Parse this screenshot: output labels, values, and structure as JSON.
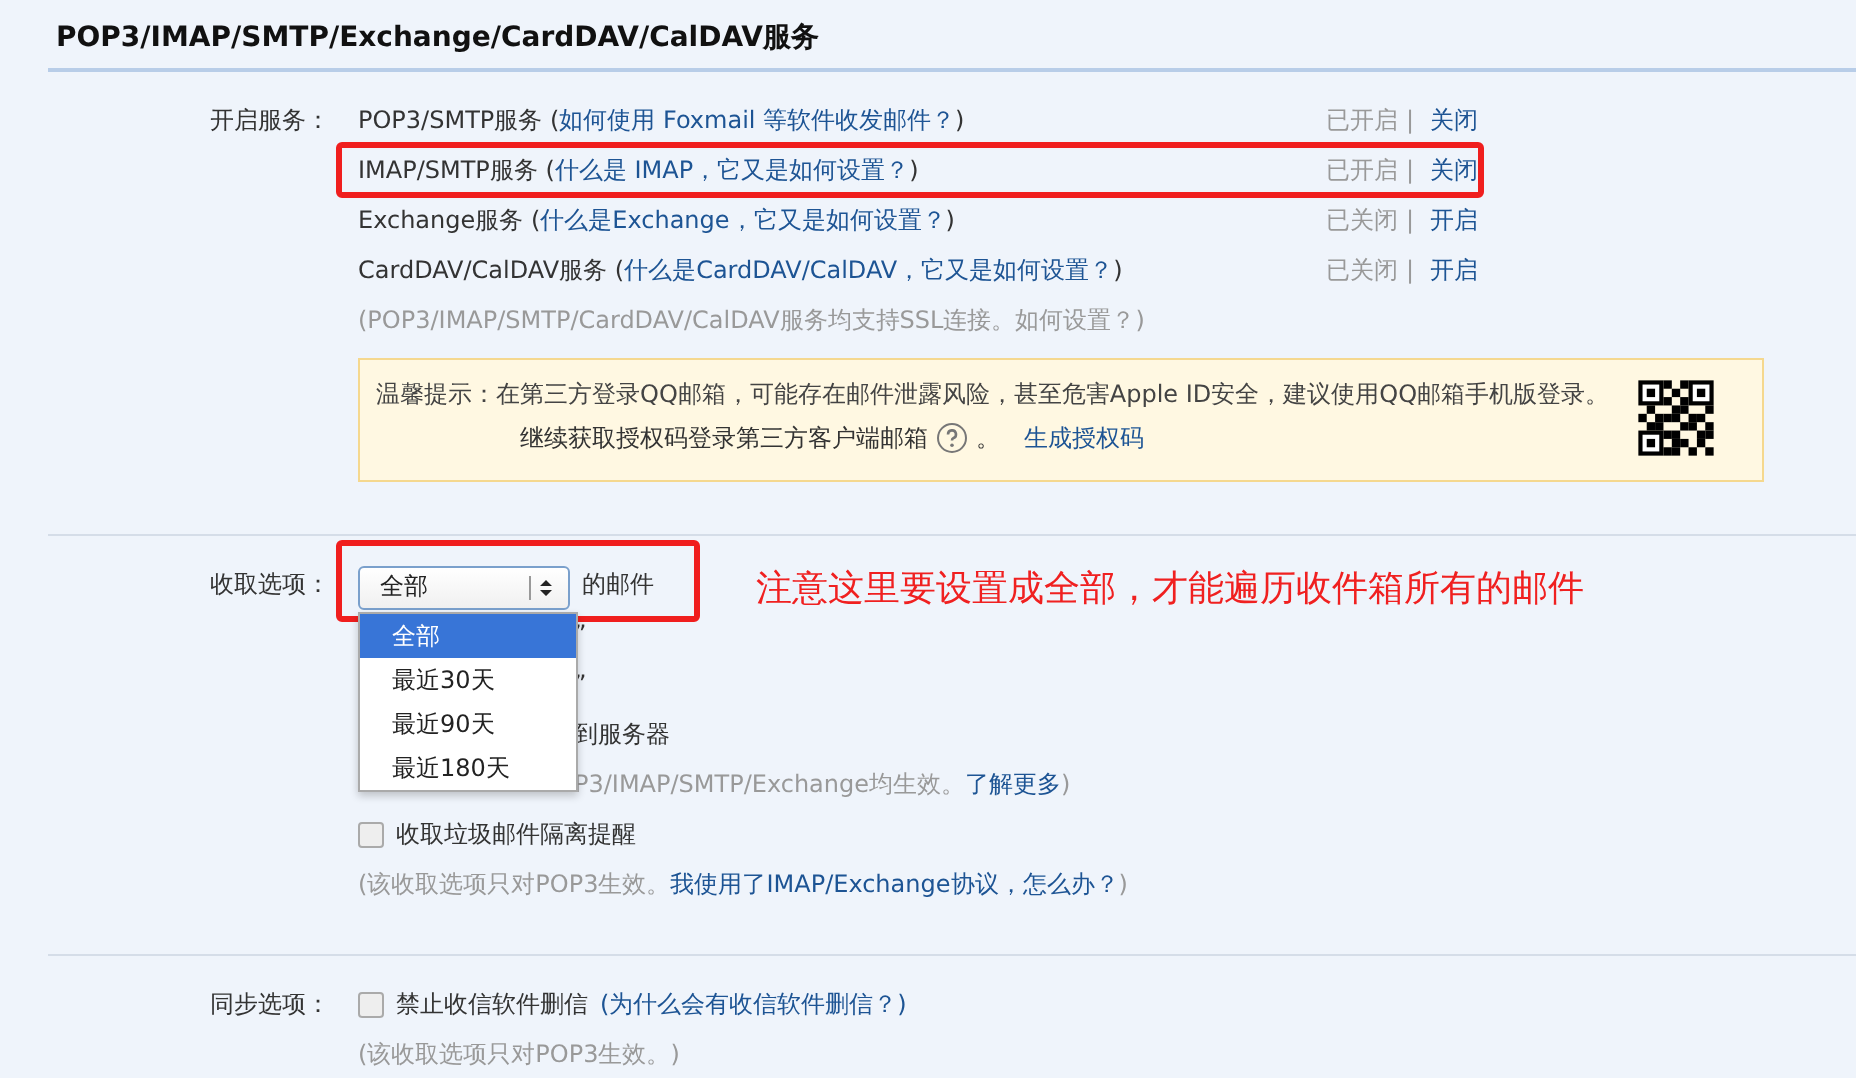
{
  "title": "POP3/IMAP/SMTP/Exchange/CardDAV/CalDAV服务",
  "services_section": {
    "label": "开启服务：",
    "separator": "|",
    "services": [
      {
        "name": "POP3/SMTP服务",
        "open": "(",
        "link": "如何使用 Foxmail 等软件收发邮件？",
        "close": ")",
        "status": "已开启",
        "action": "关闭",
        "annotated": false
      },
      {
        "name": "IMAP/SMTP服务",
        "open": "(",
        "link": "什么是 IMAP，它又是如何设置？",
        "close": ")",
        "status": "已开启",
        "action": "关闭",
        "annotated": true
      },
      {
        "name": "Exchange服务",
        "open": "(",
        "link": "什么是Exchange，它又是如何设置？",
        "close": ")",
        "status": "已关闭",
        "action": "开启",
        "annotated": false
      },
      {
        "name": "CardDAV/CalDAV服务",
        "open": "(",
        "link": "什么是CardDAV/CalDAV，它又是如何设置？",
        "close": ")",
        "status": "已关闭",
        "action": "开启",
        "annotated": false
      }
    ],
    "ssl_note": "(POP3/IMAP/SMTP/CardDAV/CalDAV服务均支持SSL连接。",
    "ssl_link": "如何设置？",
    "ssl_close": ")",
    "tip": {
      "text": "温馨提示：在第三方登录QQ邮箱，可能存在邮件泄露风险，甚至危害Apple ID安全，建议使用QQ邮箱手机版登录。",
      "line2": "继续获取授权码登录第三方客户端邮箱",
      "line2_end": "。",
      "link": "生成授权码"
    }
  },
  "receive_section": {
    "label": "收取选项：",
    "select": {
      "value": "全部",
      "suffix": "的邮件",
      "annotated": true,
      "options": [
        {
          "label": "全部",
          "selected": true
        },
        {
          "label": "最近30天",
          "selected": false
        },
        {
          "label": "最近90天",
          "selected": false
        },
        {
          "label": "最近180天",
          "selected": false
        }
      ]
    },
    "annotation": "注意这里要设置成全部，才能遍历收件箱所有的邮件",
    "covered_rows": [
      {
        "text": "”"
      },
      {
        "text": "”"
      },
      {
        "text": "到服务器"
      },
      {
        "text": "P3/IMAP/SMTP/Exchange均生效。",
        "link": "了解更多",
        "end": ")"
      }
    ],
    "checkbox": {
      "label": "收取垃圾邮件隔离提醒",
      "checked": false
    },
    "note": "(该收取选项只对POP3生效。",
    "note_link": "我使用了IMAP/Exchange协议，怎么办？",
    "note_end": ")"
  },
  "sync_section": {
    "label": "同步选项：",
    "checkbox": {
      "label": "禁止收信软件删信",
      "checked": false
    },
    "link": "(为什么会有收信软件删信？)",
    "note": "(该收取选项只对POP3生效。)"
  }
}
